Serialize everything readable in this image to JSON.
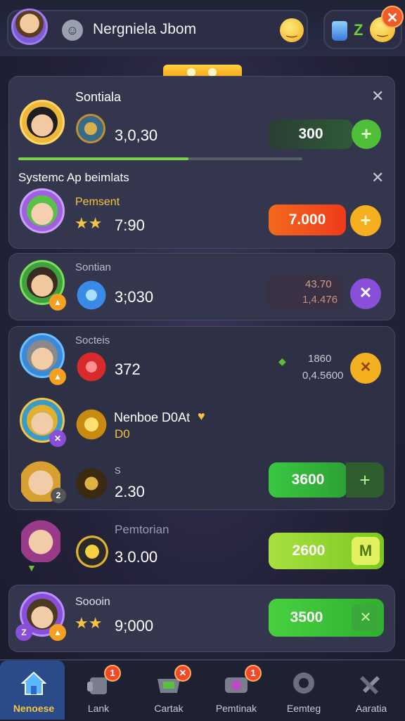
{
  "header": {
    "title": "Nergniela Jbom",
    "z_label": "Z",
    "close_glyph": "✕",
    "icons": [
      "avatar",
      "ghost-icon",
      "smiley-icon",
      "bottle-icon",
      "smiley-icon",
      "close-icon"
    ]
  },
  "panel1": {
    "title": "Sontiala",
    "value": "3,0,30",
    "button_value": "300",
    "progress": 0.6
  },
  "panel2": {
    "title": "Systemc Ap beimlats",
    "subtitle": "Pemsent",
    "value": "7:90",
    "button_value": "7.000"
  },
  "rows": [
    {
      "subtitle": "Sontian",
      "value": "3;030",
      "right_top": "43.70",
      "right_bottom": "1,4.476"
    },
    {
      "subtitle": "Socteis",
      "value": "372",
      "right_top": "1860",
      "right_bottom": "0,4.5600"
    },
    {
      "title": "Nenboe D0At",
      "sub": "D0"
    },
    {
      "subtitle": "S",
      "value": "2.30",
      "button_value": "3600"
    },
    {
      "subtitle": "Pemtorian",
      "value": "3.0.00",
      "button_value": "2600"
    },
    {
      "subtitle": "Soooin",
      "value": "9;000",
      "button_value": "3500"
    }
  ],
  "nav": [
    {
      "label": "Nenoese",
      "icon": "home-icon",
      "active": true
    },
    {
      "label": "Lank",
      "icon": "hand-icon",
      "badge": "1"
    },
    {
      "label": "Cartak",
      "icon": "cart-icon",
      "badge": "✕"
    },
    {
      "label": "Pemtinak",
      "icon": "camera-icon",
      "badge": "1"
    },
    {
      "label": "Eemteg",
      "icon": "gear-icon"
    },
    {
      "label": "Aaratia",
      "icon": "tools-icon"
    }
  ],
  "colors": {
    "accent_green": "#4fd23a",
    "accent_orange": "#f25a1c",
    "accent_yellow": "#f5c542",
    "accent_purple": "#8a4fd8"
  }
}
